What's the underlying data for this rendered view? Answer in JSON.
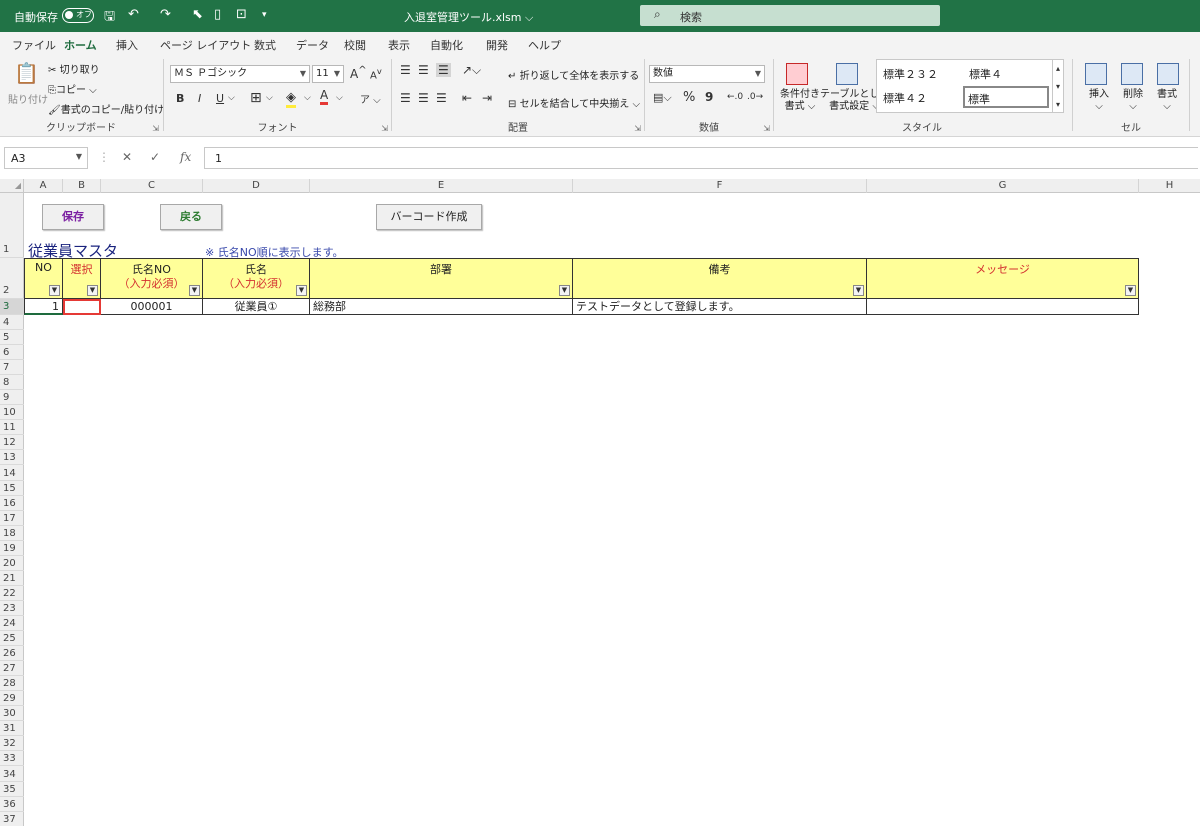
{
  "titlebar": {
    "autosave_label": "自動保存",
    "autosave_state": "オフ",
    "document_title": "入退室管理ツール.xlsm",
    "search_placeholder": "検索"
  },
  "tabs": [
    "ファイル",
    "ホーム",
    "挿入",
    "ページ レイアウト",
    "数式",
    "データ",
    "校閲",
    "表示",
    "自動化",
    "開発",
    "ヘルプ"
  ],
  "active_tab": "ホーム",
  "ribbon": {
    "clipboard": {
      "name": "クリップボード",
      "paste": "貼り付け",
      "cut": "切り取り",
      "copy": "コピー",
      "format_painter": "書式のコピー/貼り付け"
    },
    "font": {
      "name": "フォント",
      "font_name": "ＭＳ Ｐゴシック",
      "font_size": "11",
      "bold": "B",
      "italic": "I",
      "underline": "U",
      "grow": "A",
      "shrink": "A",
      "phonetic": "ア",
      "font_color_letter": "A"
    },
    "alignment": {
      "name": "配置",
      "wrap": "折り返して全体を表示する",
      "merge": "セルを結合して中央揃え"
    },
    "number": {
      "name": "数値",
      "format": "数値",
      "percent": "%",
      "comma": "9"
    },
    "styles": {
      "name": "スタイル",
      "conditional": [
        "条件付き",
        "書式"
      ],
      "table": [
        "テーブルとして",
        "書式設定"
      ],
      "cells": [
        "標準２３２",
        "標準４",
        "標準４２",
        "標準"
      ]
    },
    "cells": {
      "name": "セル",
      "insert": "挿入",
      "delete": "削除",
      "format": "書式"
    }
  },
  "formula_bar": {
    "name_box": "A3",
    "cancel": "✕",
    "enter": "✓",
    "fx": "fx",
    "value": "1"
  },
  "columns": [
    "A",
    "B",
    "C",
    "D",
    "E",
    "F",
    "G",
    "H"
  ],
  "rows": [
    "1",
    "2",
    "3",
    "4",
    "5",
    "6",
    "7",
    "8",
    "9",
    "10",
    "11",
    "12",
    "13",
    "14",
    "15",
    "16",
    "17",
    "18",
    "19",
    "20",
    "21",
    "22",
    "23",
    "24",
    "25",
    "26",
    "27",
    "28",
    "29",
    "30",
    "31",
    "32",
    "33",
    "34",
    "35",
    "36",
    "37"
  ],
  "sheet": {
    "buttons": {
      "save": "保存",
      "back": "戻る",
      "barcode": "バーコード作成"
    },
    "title": "従業員マスタ",
    "note": "※ 氏名NO順に表示します。",
    "headers": [
      {
        "line1": "NO",
        "line2": ""
      },
      {
        "line1": "選択",
        "line2": ""
      },
      {
        "line1": "氏名NO",
        "line2": "（入力必須）"
      },
      {
        "line1": "氏名",
        "line2": "（入力必須）"
      },
      {
        "line1": "部署",
        "line2": ""
      },
      {
        "line1": "備考",
        "line2": ""
      },
      {
        "line1": "メッセージ",
        "line2": ""
      }
    ],
    "row": {
      "no": "1",
      "select": "",
      "emp_no": "000001",
      "name": "従業員①",
      "dept": "総務部",
      "remarks": "テストデータとして登録します。",
      "message": ""
    }
  },
  "colors": {
    "brand": "#217346",
    "header_fill": "#ffff99",
    "required": "#d32f2f",
    "title": "#1a237e"
  }
}
